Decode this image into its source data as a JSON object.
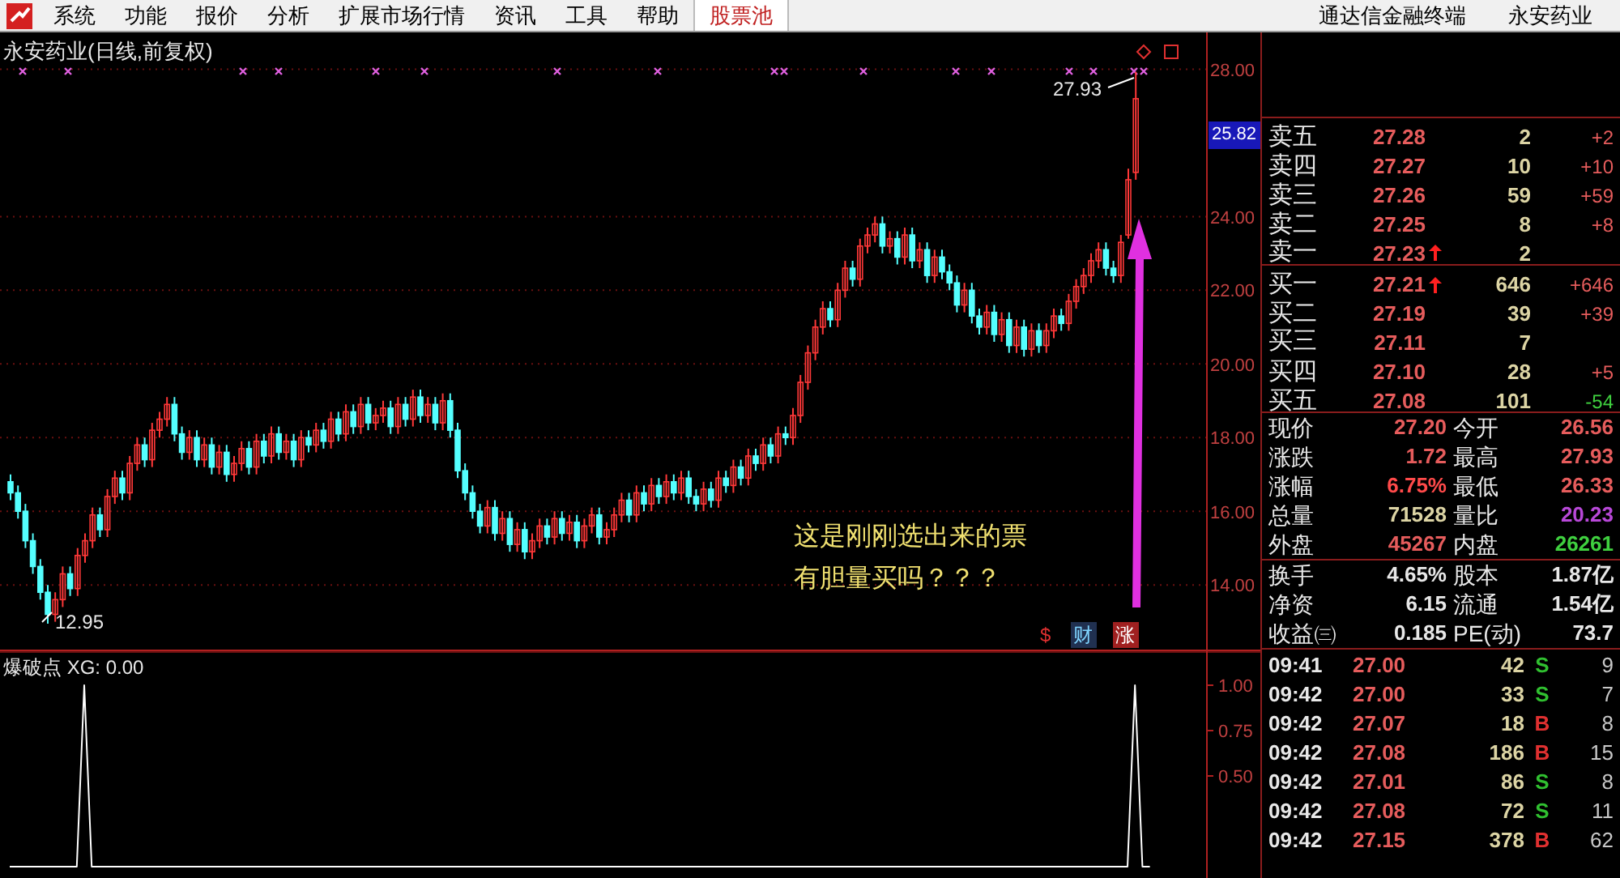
{
  "menu": {
    "items": [
      {
        "label": "系统",
        "selected": false
      },
      {
        "label": "功能",
        "selected": false
      },
      {
        "label": "报价",
        "selected": false
      },
      {
        "label": "分析",
        "selected": false
      },
      {
        "label": "扩展市场行情",
        "selected": false
      },
      {
        "label": "资讯",
        "selected": false
      },
      {
        "label": "工具",
        "selected": false
      },
      {
        "label": "帮助",
        "selected": false
      },
      {
        "label": "股票池",
        "selected": true
      }
    ],
    "right": [
      "通达信金融终端",
      "永安药业"
    ]
  },
  "chart": {
    "title": "永安药业(日线,前复权)",
    "crosshair_price": "25.82",
    "high_label": "27.93",
    "low_label": "12.95",
    "note_lines": [
      "这是刚刚选出来的票",
      "有胆量买吗？？？"
    ],
    "markers": [
      {
        "text": "$",
        "kind": "dollar"
      },
      {
        "text": "财",
        "kind": "finance"
      },
      {
        "text": "涨",
        "kind": "rise"
      }
    ],
    "chart_data": {
      "type": "candlestick",
      "grid": true,
      "ylim": [
        12.2,
        29
      ],
      "yticks": [
        {
          "value": 28,
          "label": "28.00"
        },
        {
          "value": 24,
          "label": "24.00"
        },
        {
          "value": 22,
          "label": "22.00"
        },
        {
          "value": 20,
          "label": "20.00"
        },
        {
          "value": 18,
          "label": "18.00"
        },
        {
          "value": 16,
          "label": "16.00"
        },
        {
          "value": 14,
          "label": "14.00"
        }
      ],
      "ohlc": [
        [
          16.8,
          17.0,
          16.3,
          16.5
        ],
        [
          16.5,
          16.7,
          15.8,
          16.0
        ],
        [
          16.0,
          16.2,
          15.0,
          15.2
        ],
        [
          15.2,
          15.4,
          14.3,
          14.5
        ],
        [
          14.5,
          14.7,
          13.6,
          13.8
        ],
        [
          13.8,
          14.0,
          12.95,
          13.2
        ],
        [
          13.2,
          13.8,
          13.0,
          13.6
        ],
        [
          13.6,
          14.5,
          13.4,
          14.3
        ],
        [
          14.3,
          14.5,
          13.7,
          13.9
        ],
        [
          13.9,
          15.0,
          13.7,
          14.8
        ],
        [
          14.8,
          15.4,
          14.6,
          15.2
        ],
        [
          15.2,
          16.1,
          15.0,
          15.9
        ],
        [
          15.9,
          16.1,
          15.3,
          15.5
        ],
        [
          15.5,
          16.6,
          15.3,
          16.4
        ],
        [
          16.4,
          17.1,
          16.2,
          16.9
        ],
        [
          16.9,
          17.1,
          16.3,
          16.5
        ],
        [
          16.5,
          17.5,
          16.3,
          17.3
        ],
        [
          17.3,
          18.0,
          17.1,
          17.8
        ],
        [
          17.8,
          18.0,
          17.2,
          17.4
        ],
        [
          17.4,
          18.4,
          17.2,
          18.2
        ],
        [
          18.2,
          18.7,
          18.0,
          18.5
        ],
        [
          18.5,
          19.1,
          18.3,
          18.9
        ],
        [
          18.9,
          19.1,
          17.9,
          18.1
        ],
        [
          18.1,
          18.3,
          17.4,
          17.6
        ],
        [
          17.6,
          18.2,
          17.4,
          18.0
        ],
        [
          18.0,
          18.2,
          17.2,
          17.4
        ],
        [
          17.4,
          18.0,
          17.2,
          17.8
        ],
        [
          17.8,
          18.0,
          17.0,
          17.2
        ],
        [
          17.2,
          17.8,
          17.0,
          17.6
        ],
        [
          17.6,
          17.8,
          16.8,
          17.0
        ],
        [
          17.0,
          17.5,
          16.8,
          17.3
        ],
        [
          17.3,
          17.9,
          17.1,
          17.7
        ],
        [
          17.7,
          17.9,
          17.0,
          17.2
        ],
        [
          17.2,
          18.1,
          17.0,
          17.9
        ],
        [
          17.9,
          18.1,
          17.3,
          17.5
        ],
        [
          17.5,
          18.3,
          17.3,
          18.1
        ],
        [
          18.1,
          18.3,
          17.4,
          17.6
        ],
        [
          17.6,
          18.1,
          17.4,
          17.9
        ],
        [
          17.9,
          18.1,
          17.2,
          17.4
        ],
        [
          17.4,
          18.2,
          17.2,
          18.0
        ],
        [
          18.0,
          18.2,
          17.6,
          17.8
        ],
        [
          17.8,
          18.4,
          17.6,
          18.2
        ],
        [
          18.2,
          18.4,
          17.7,
          17.9
        ],
        [
          17.9,
          18.7,
          17.7,
          18.5
        ],
        [
          18.5,
          18.7,
          17.9,
          18.1
        ],
        [
          18.1,
          18.9,
          17.9,
          18.7
        ],
        [
          18.7,
          18.9,
          18.1,
          18.3
        ],
        [
          18.3,
          19.1,
          18.1,
          18.9
        ],
        [
          18.9,
          19.1,
          18.2,
          18.4
        ],
        [
          18.4,
          18.8,
          18.2,
          18.6
        ],
        [
          18.6,
          19.0,
          18.4,
          18.8
        ],
        [
          18.8,
          19.0,
          18.1,
          18.3
        ],
        [
          18.3,
          19.1,
          18.1,
          18.9
        ],
        [
          18.9,
          19.1,
          18.3,
          18.5
        ],
        [
          18.5,
          19.3,
          18.3,
          19.1
        ],
        [
          19.1,
          19.3,
          18.4,
          18.6
        ],
        [
          18.6,
          19.1,
          18.4,
          18.9
        ],
        [
          18.9,
          19.1,
          18.2,
          18.4
        ],
        [
          18.4,
          19.2,
          18.2,
          19.0
        ],
        [
          19.0,
          19.2,
          18.0,
          18.2
        ],
        [
          18.2,
          18.4,
          16.9,
          17.1
        ],
        [
          17.1,
          17.3,
          16.3,
          16.5
        ],
        [
          16.5,
          16.7,
          15.8,
          16.0
        ],
        [
          16.0,
          16.2,
          15.4,
          15.6
        ],
        [
          15.6,
          16.3,
          15.4,
          16.1
        ],
        [
          16.1,
          16.3,
          15.2,
          15.4
        ],
        [
          15.4,
          16.0,
          15.2,
          15.8
        ],
        [
          15.8,
          16.0,
          14.9,
          15.1
        ],
        [
          15.1,
          15.7,
          14.9,
          15.5
        ],
        [
          15.5,
          15.7,
          14.7,
          14.9
        ],
        [
          14.9,
          15.4,
          14.7,
          15.2
        ],
        [
          15.2,
          15.8,
          15.0,
          15.6
        ],
        [
          15.6,
          15.8,
          15.1,
          15.3
        ],
        [
          15.3,
          16.0,
          15.1,
          15.8
        ],
        [
          15.8,
          16.0,
          15.2,
          15.4
        ],
        [
          15.4,
          15.9,
          15.2,
          15.7
        ],
        [
          15.7,
          15.9,
          15.0,
          15.2
        ],
        [
          15.2,
          15.8,
          15.0,
          15.6
        ],
        [
          15.6,
          16.1,
          15.4,
          15.9
        ],
        [
          15.9,
          16.1,
          15.1,
          15.3
        ],
        [
          15.3,
          15.7,
          15.1,
          15.5
        ],
        [
          15.5,
          16.1,
          15.3,
          15.9
        ],
        [
          15.9,
          16.5,
          15.7,
          16.3
        ],
        [
          16.3,
          16.5,
          15.7,
          15.9
        ],
        [
          15.9,
          16.7,
          15.7,
          16.5
        ],
        [
          16.5,
          16.7,
          16.0,
          16.2
        ],
        [
          16.2,
          16.9,
          16.0,
          16.7
        ],
        [
          16.7,
          16.9,
          16.2,
          16.4
        ],
        [
          16.4,
          17.0,
          16.2,
          16.8
        ],
        [
          16.8,
          17.0,
          16.3,
          16.5
        ],
        [
          16.5,
          17.1,
          16.3,
          16.9
        ],
        [
          16.9,
          17.1,
          16.2,
          16.4
        ],
        [
          16.4,
          16.6,
          16.0,
          16.2
        ],
        [
          16.2,
          16.8,
          16.0,
          16.6
        ],
        [
          16.6,
          16.8,
          16.1,
          16.3
        ],
        [
          16.3,
          17.1,
          16.1,
          16.9
        ],
        [
          16.9,
          17.1,
          16.5,
          16.7
        ],
        [
          16.7,
          17.4,
          16.5,
          17.2
        ],
        [
          17.2,
          17.4,
          16.7,
          16.9
        ],
        [
          16.9,
          17.7,
          16.7,
          17.5
        ],
        [
          17.5,
          17.7,
          17.1,
          17.3
        ],
        [
          17.3,
          18.0,
          17.1,
          17.8
        ],
        [
          17.8,
          18.0,
          17.3,
          17.5
        ],
        [
          17.5,
          18.3,
          17.3,
          18.1
        ],
        [
          18.1,
          18.3,
          17.8,
          18.0
        ],
        [
          18.0,
          18.8,
          17.8,
          18.6
        ],
        [
          18.6,
          19.7,
          18.4,
          19.5
        ],
        [
          19.5,
          20.5,
          19.3,
          20.3
        ],
        [
          20.3,
          21.2,
          20.1,
          21.0
        ],
        [
          21.0,
          21.7,
          20.8,
          21.5
        ],
        [
          21.5,
          21.7,
          21.0,
          21.2
        ],
        [
          21.2,
          22.2,
          21.0,
          22.0
        ],
        [
          22.0,
          22.8,
          21.8,
          22.6
        ],
        [
          22.6,
          22.8,
          22.1,
          22.3
        ],
        [
          22.3,
          23.4,
          22.1,
          23.2
        ],
        [
          23.2,
          23.7,
          23.0,
          23.5
        ],
        [
          23.5,
          24.0,
          23.3,
          23.8
        ],
        [
          23.8,
          24.0,
          23.0,
          23.2
        ],
        [
          23.2,
          23.6,
          23.0,
          23.4
        ],
        [
          23.4,
          23.6,
          22.7,
          22.9
        ],
        [
          22.9,
          23.7,
          22.7,
          23.5
        ],
        [
          23.5,
          23.7,
          22.6,
          22.8
        ],
        [
          22.8,
          23.3,
          22.6,
          23.1
        ],
        [
          23.1,
          23.3,
          22.2,
          22.4
        ],
        [
          22.4,
          23.1,
          22.2,
          22.9
        ],
        [
          22.9,
          23.1,
          22.3,
          22.5
        ],
        [
          22.5,
          22.7,
          22.0,
          22.2
        ],
        [
          22.2,
          22.4,
          21.4,
          21.6
        ],
        [
          21.6,
          22.2,
          21.4,
          22.0
        ],
        [
          22.0,
          22.2,
          21.1,
          21.3
        ],
        [
          21.3,
          21.5,
          20.8,
          21.0
        ],
        [
          21.0,
          21.6,
          20.8,
          21.4
        ],
        [
          21.4,
          21.6,
          20.6,
          20.8
        ],
        [
          20.8,
          21.4,
          20.6,
          21.2
        ],
        [
          21.2,
          21.4,
          20.3,
          20.5
        ],
        [
          20.5,
          21.2,
          20.3,
          21.0
        ],
        [
          21.0,
          21.2,
          20.2,
          20.4
        ],
        [
          20.4,
          21.1,
          20.2,
          20.9
        ],
        [
          20.9,
          21.1,
          20.3,
          20.5
        ],
        [
          20.5,
          21.1,
          20.3,
          20.9
        ],
        [
          20.9,
          21.5,
          20.7,
          21.3
        ],
        [
          21.3,
          21.5,
          20.9,
          21.1
        ],
        [
          21.1,
          21.9,
          20.9,
          21.7
        ],
        [
          21.7,
          22.3,
          21.5,
          22.1
        ],
        [
          22.1,
          22.6,
          21.9,
          22.4
        ],
        [
          22.4,
          23.0,
          22.2,
          22.8
        ],
        [
          22.8,
          23.3,
          22.6,
          23.1
        ],
        [
          23.1,
          23.3,
          22.4,
          22.6
        ],
        [
          22.6,
          22.8,
          22.2,
          22.4
        ],
        [
          22.4,
          23.5,
          22.2,
          23.3
        ],
        [
          23.5,
          25.3,
          23.4,
          25.0
        ],
        [
          25.2,
          27.93,
          25.0,
          27.2
        ]
      ]
    }
  },
  "indicator": {
    "title": "爆破点 XG: 0.00",
    "chart_data": {
      "type": "line",
      "ylim": [
        -0.0625,
        1.1875
      ],
      "yticks": [
        {
          "value": 1,
          "label": "1.00"
        },
        {
          "value": 0.75,
          "label": "0.75"
        },
        {
          "value": 0.5,
          "label": "0.50"
        }
      ],
      "series": [
        {
          "color": "#ffffff",
          "values": [
            0,
            0,
            0,
            0,
            0,
            0,
            0,
            0,
            0,
            0,
            1,
            0,
            0,
            0,
            0,
            0,
            0,
            0,
            0,
            0,
            0,
            0,
            0,
            0,
            0,
            0,
            0,
            0,
            0,
            0,
            0,
            0,
            0,
            0,
            0,
            0,
            0,
            0,
            0,
            0,
            0,
            0,
            0,
            0,
            0,
            0,
            0,
            0,
            0,
            0,
            0,
            0,
            0,
            0,
            0,
            0,
            0,
            0,
            0,
            0,
            0,
            0,
            0,
            0,
            0,
            0,
            0,
            0,
            0,
            0,
            0,
            0,
            0,
            0,
            0,
            0,
            0,
            0,
            0,
            0,
            0,
            0,
            0,
            0,
            0,
            0,
            0,
            0,
            0,
            0,
            0,
            0,
            0,
            0,
            0,
            0,
            0,
            0,
            0,
            0,
            0,
            0,
            0,
            0,
            0,
            0,
            0,
            0,
            0,
            0,
            0,
            0,
            0,
            0,
            0,
            0,
            0,
            0,
            0,
            0,
            0,
            0,
            0,
            0,
            0,
            0,
            0,
            0,
            0,
            0,
            0,
            0,
            0,
            0,
            0,
            0,
            0,
            0,
            0,
            0,
            0,
            0,
            0,
            0,
            0,
            0,
            0,
            0,
            0,
            0,
            0,
            1,
            0,
            0
          ]
        }
      ]
    }
  },
  "order_book": {
    "asks": [
      {
        "label": "卖五",
        "price": "27.28",
        "arrow": false,
        "volume": "2",
        "change": "+2",
        "color": "#e65c5c"
      },
      {
        "label": "卖四",
        "price": "27.27",
        "arrow": false,
        "volume": "10",
        "change": "+10",
        "color": "#e65c5c"
      },
      {
        "label": "卖三",
        "price": "27.26",
        "arrow": false,
        "volume": "59",
        "change": "+59",
        "color": "#e65c5c"
      },
      {
        "label": "卖二",
        "price": "27.25",
        "arrow": false,
        "volume": "8",
        "change": "+8",
        "color": "#e65c5c"
      },
      {
        "label": "卖一",
        "price": "27.23",
        "arrow": true,
        "volume": "2"
      }
    ],
    "bids": [
      {
        "label": "买一",
        "price": "27.21",
        "arrow": true,
        "volume": "646",
        "change": "+646",
        "color": "#e65c5c"
      },
      {
        "label": "买二",
        "price": "27.19",
        "arrow": false,
        "volume": "39",
        "change": "+39",
        "color": "#e65c5c"
      },
      {
        "label": "买三",
        "price": "27.11",
        "arrow": false,
        "volume": "7"
      },
      {
        "label": "买四",
        "price": "27.10",
        "arrow": false,
        "volume": "28",
        "change": "+5",
        "color": "#e65c5c"
      },
      {
        "label": "买五",
        "price": "27.08",
        "arrow": false,
        "volume": "101",
        "change": "-54",
        "color": "#3fd03f"
      }
    ]
  },
  "quotes": [
    {
      "label": "现价",
      "value": "27.20",
      "color": "#e65c5c"
    },
    {
      "label": "今开",
      "value": "26.56",
      "color": "#e65c5c"
    },
    {
      "label": "涨跌",
      "value": "1.72",
      "color": "#e65c5c"
    },
    {
      "label": "最高",
      "value": "27.93",
      "color": "#e65c5c"
    },
    {
      "label": "涨幅",
      "value": "6.75%",
      "color": "#ff4a4a"
    },
    {
      "label": "最低",
      "value": "26.33",
      "color": "#e65c5c"
    },
    {
      "label": "总量",
      "value": "71528",
      "color": "#dcd4a4"
    },
    {
      "label": "量比",
      "value": "20.23",
      "color": "#b848d8"
    },
    {
      "label": "外盘",
      "value": "45267",
      "color": "#e65c5c"
    },
    {
      "label": "内盘",
      "value": "26261",
      "color": "#3fd03f"
    }
  ],
  "fundamentals": [
    {
      "label": "换手",
      "value": "4.65%"
    },
    {
      "label": "股本",
      "value": "1.87亿"
    },
    {
      "label": "净资",
      "value": "6.15"
    },
    {
      "label": "流通",
      "value": "1.54亿"
    },
    {
      "label": "收益㈢",
      "value": "0.185"
    },
    {
      "label": "PE(动)",
      "value": "73.7"
    }
  ],
  "trades": [
    {
      "time": "09:41",
      "price": "27.00",
      "volume": "42",
      "flag": "S",
      "buy": false,
      "count": "9"
    },
    {
      "time": "09:42",
      "price": "27.00",
      "volume": "33",
      "flag": "S",
      "buy": false,
      "count": "7"
    },
    {
      "time": "09:42",
      "price": "27.07",
      "volume": "18",
      "flag": "B",
      "buy": true,
      "count": "8"
    },
    {
      "time": "09:42",
      "price": "27.08",
      "volume": "186",
      "flag": "B",
      "buy": true,
      "count": "15"
    },
    {
      "time": "09:42",
      "price": "27.01",
      "volume": "86",
      "flag": "S",
      "buy": false,
      "count": "8"
    },
    {
      "time": "09:42",
      "price": "27.08",
      "volume": "72",
      "flag": "S",
      "buy": false,
      "count": "11"
    },
    {
      "time": "09:42",
      "price": "27.15",
      "volume": "378",
      "flag": "B",
      "buy": true,
      "count": "62"
    }
  ]
}
